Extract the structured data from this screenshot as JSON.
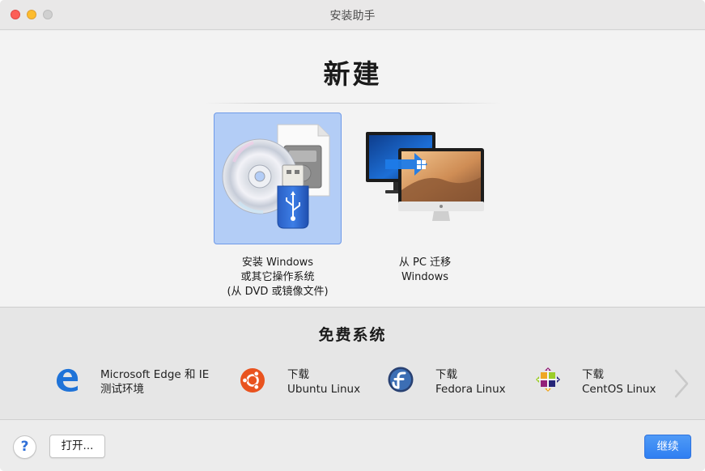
{
  "window": {
    "title": "安装助手"
  },
  "upper": {
    "heading": "新建",
    "options": [
      {
        "line1": "安装 Windows",
        "line2": "或其它操作系统",
        "line3": "(从 DVD 或镜像文件)",
        "selected": true,
        "icon": "disc-usb-icon"
      },
      {
        "line1": "从 PC 迁移",
        "line2": "Windows",
        "selected": false,
        "icon": "pc-to-mac-icon"
      }
    ]
  },
  "free": {
    "title": "免费系统",
    "items": [
      {
        "line1": "Microsoft Edge 和 IE",
        "line2": "测试环境",
        "icon": "edge-icon"
      },
      {
        "line1": "下载",
        "line2": "Ubuntu Linux",
        "icon": "ubuntu-icon"
      },
      {
        "line1": "下载",
        "line2": "Fedora Linux",
        "icon": "fedora-icon"
      },
      {
        "line1": "下载",
        "line2": "CentOS Linux",
        "icon": "centos-icon"
      }
    ]
  },
  "bottom": {
    "help_label": "?",
    "open_label": "打开...",
    "continue_label": "继续"
  },
  "colors": {
    "accent": "#3486f4",
    "selection": "#b3cdf6"
  }
}
